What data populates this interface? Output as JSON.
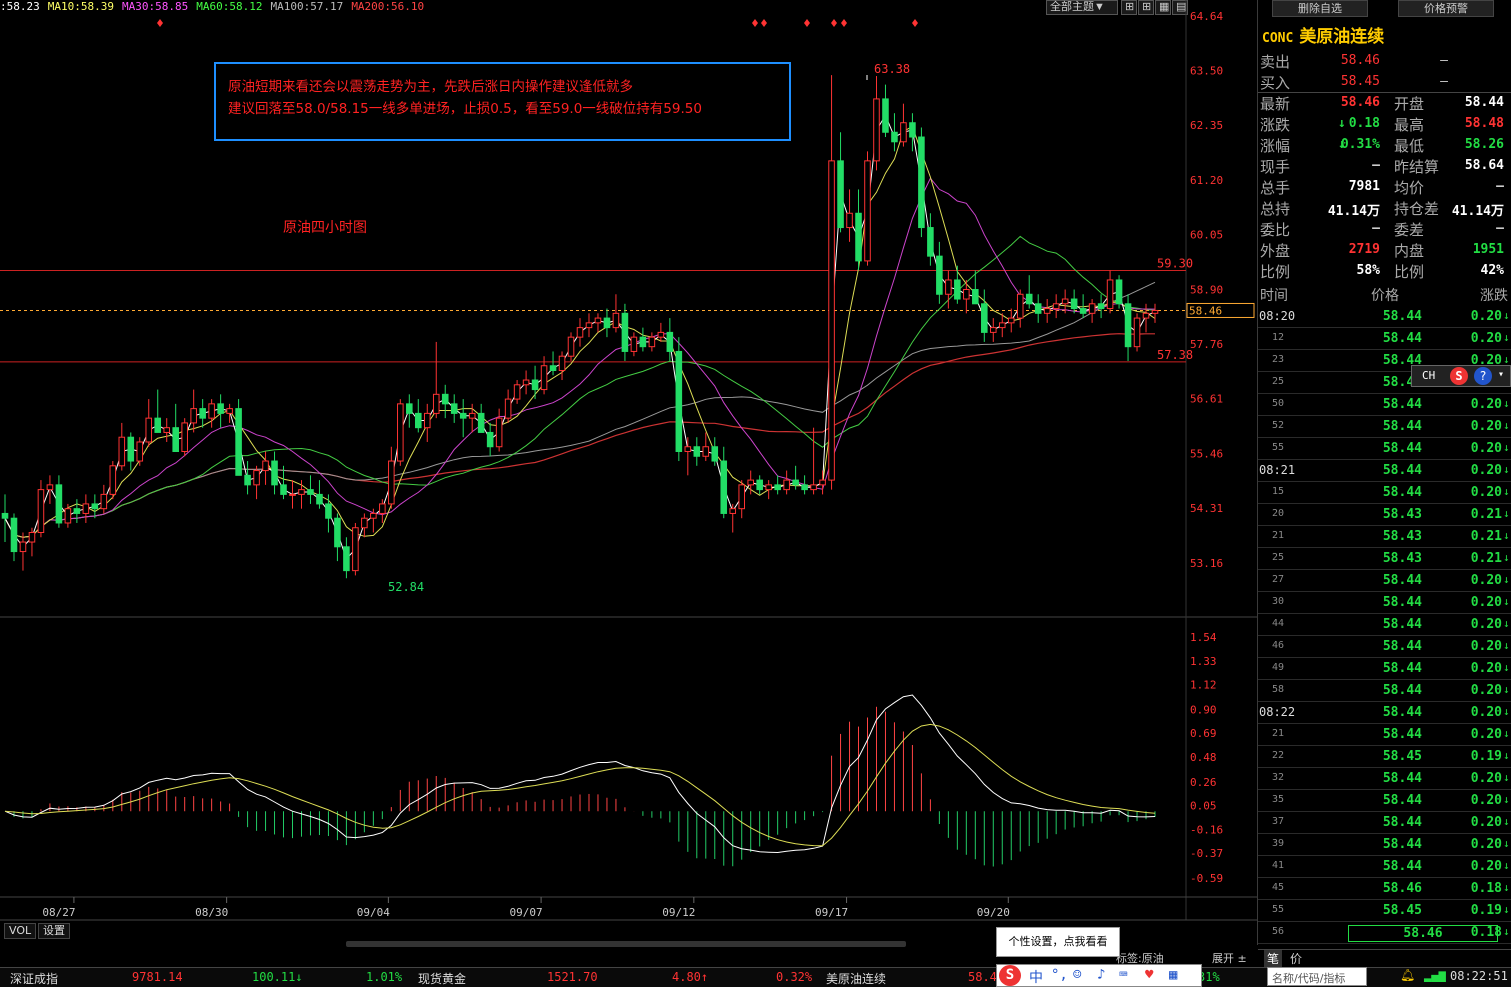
{
  "ma_legend": [
    {
      "label": ":58.23",
      "color": "#ffffff"
    },
    {
      "label": "MA10:58.39",
      "color": "#ffff66"
    },
    {
      "label": "MA30:58.85",
      "color": "#ff55ff"
    },
    {
      "label": "MA60:58.12",
      "color": "#44ff44"
    },
    {
      "label": "MA100:57.17",
      "color": "#bbbbbb"
    },
    {
      "label": "MA200:56.10",
      "color": "#ff4444"
    }
  ],
  "toolbar": {
    "theme_label": "全部主题▼",
    "icons": [
      "grid-icon",
      "grid-plus-icon",
      "grid-small-icon",
      "grid-large-icon"
    ]
  },
  "note": {
    "line1": "原油短期来看还会以震荡走势为主，先跌后涨日内操作建议逢低就多",
    "line2": "建议回落至58.0/58.15一线多单进场，止损0.5，看至59.0一线破位持有59.50"
  },
  "chart_title": "原油四小时图",
  "chart_data": [
    {
      "type": "candlestick",
      "title": "",
      "ylim": [
        52.2,
        64.9
      ],
      "y_ticks": [
        "64.64",
        "63.50",
        "62.35",
        "61.20",
        "60.05",
        "58.90",
        "57.76",
        "56.61",
        "55.46",
        "54.31",
        "53.16"
      ],
      "y_tick_values": [
        64.64,
        63.5,
        62.35,
        61.2,
        60.05,
        58.9,
        57.76,
        56.61,
        55.46,
        54.31,
        53.16
      ],
      "x_labels": [
        "08/27",
        "08/30",
        "09/04",
        "09/07",
        "09/12",
        "09/17",
        "09/20"
      ],
      "x_label_index": [
        6,
        23,
        41,
        58,
        75,
        92,
        110
      ],
      "annotations": {
        "high": "63.38",
        "low": "52.84",
        "line_upper": "59.30",
        "line_lower": "57.38",
        "current": "58.46"
      },
      "horizontal_lines": [
        59.3,
        57.38
      ],
      "current_price": 58.46,
      "candles_ohlc": [
        [
          54.2,
          54.6,
          53.6,
          54.1
        ],
        [
          54.1,
          54.2,
          53.2,
          53.4
        ],
        [
          53.4,
          53.8,
          53.0,
          53.6
        ],
        [
          53.6,
          53.9,
          53.3,
          53.8
        ],
        [
          53.8,
          54.9,
          53.7,
          54.7
        ],
        [
          54.7,
          55.0,
          54.4,
          54.8
        ],
        [
          54.8,
          55.0,
          53.9,
          54.0
        ],
        [
          54.0,
          54.4,
          53.9,
          54.3
        ],
        [
          54.3,
          54.5,
          54.0,
          54.2
        ],
        [
          54.2,
          54.6,
          54.0,
          54.4
        ],
        [
          54.4,
          54.6,
          54.1,
          54.3
        ],
        [
          54.3,
          54.8,
          54.2,
          54.6
        ],
        [
          54.6,
          55.3,
          54.5,
          55.2
        ],
        [
          55.2,
          56.1,
          55.1,
          55.8
        ],
        [
          55.8,
          55.9,
          55.1,
          55.3
        ],
        [
          55.3,
          55.8,
          55.2,
          55.7
        ],
        [
          55.7,
          56.6,
          55.6,
          56.2
        ],
        [
          56.2,
          56.8,
          56.0,
          55.9
        ],
        [
          55.9,
          56.2,
          55.7,
          56.0
        ],
        [
          56.0,
          56.5,
          55.8,
          55.5
        ],
        [
          55.5,
          56.2,
          55.4,
          56.1
        ],
        [
          56.1,
          56.8,
          55.9,
          56.4
        ],
        [
          56.4,
          56.6,
          56.0,
          56.2
        ],
        [
          56.2,
          56.6,
          56.0,
          56.5
        ],
        [
          56.5,
          56.7,
          56.0,
          56.3
        ],
        [
          56.3,
          56.5,
          56.1,
          56.4
        ],
        [
          56.4,
          56.6,
          55.3,
          55.0
        ],
        [
          55.0,
          55.3,
          54.6,
          54.8
        ],
        [
          54.8,
          55.2,
          54.5,
          55.1
        ],
        [
          55.1,
          55.5,
          54.8,
          55.3
        ],
        [
          55.3,
          55.5,
          54.6,
          54.8
        ],
        [
          54.8,
          55.2,
          54.5,
          54.6
        ],
        [
          54.6,
          54.9,
          54.3,
          54.6
        ],
        [
          54.6,
          54.9,
          54.3,
          54.7
        ],
        [
          54.7,
          55.0,
          54.4,
          54.6
        ],
        [
          54.6,
          54.9,
          54.3,
          54.4
        ],
        [
          54.4,
          54.6,
          53.8,
          54.1
        ],
        [
          54.1,
          54.2,
          53.2,
          53.5
        ],
        [
          53.5,
          53.7,
          52.84,
          53.0
        ],
        [
          53.0,
          54.0,
          52.9,
          53.9
        ],
        [
          53.9,
          54.2,
          53.7,
          54.1
        ],
        [
          54.1,
          54.3,
          53.8,
          54.2
        ],
        [
          54.2,
          54.5,
          54.0,
          54.4
        ],
        [
          54.4,
          55.6,
          54.3,
          55.3
        ],
        [
          55.3,
          56.6,
          55.2,
          56.5
        ],
        [
          56.5,
          56.7,
          56.0,
          56.3
        ],
        [
          56.3,
          56.6,
          55.9,
          56.0
        ],
        [
          56.0,
          56.5,
          55.7,
          56.3
        ],
        [
          56.3,
          57.8,
          56.2,
          56.7
        ],
        [
          56.7,
          56.9,
          56.2,
          56.5
        ],
        [
          56.5,
          56.7,
          56.1,
          56.3
        ],
        [
          56.3,
          56.6,
          55.8,
          56.2
        ],
        [
          56.2,
          56.5,
          55.9,
          56.3
        ],
        [
          56.3,
          56.5,
          56.0,
          55.9
        ],
        [
          55.9,
          56.1,
          55.4,
          55.6
        ],
        [
          55.6,
          56.4,
          55.5,
          56.2
        ],
        [
          56.2,
          56.8,
          56.1,
          56.6
        ],
        [
          56.6,
          57.0,
          56.5,
          56.9
        ],
        [
          56.9,
          57.2,
          56.7,
          57.0
        ],
        [
          57.0,
          57.3,
          56.6,
          56.8
        ],
        [
          56.8,
          57.5,
          56.7,
          57.3
        ],
        [
          57.3,
          57.6,
          57.1,
          57.2
        ],
        [
          57.2,
          57.6,
          57.0,
          57.5
        ],
        [
          57.5,
          58.0,
          57.4,
          57.9
        ],
        [
          57.9,
          58.3,
          57.7,
          58.1
        ],
        [
          58.1,
          58.4,
          57.9,
          58.2
        ],
        [
          58.2,
          58.4,
          58.0,
          58.3
        ],
        [
          58.3,
          58.5,
          57.9,
          58.1
        ],
        [
          58.1,
          58.8,
          58.0,
          58.4
        ],
        [
          58.4,
          58.6,
          57.4,
          57.6
        ],
        [
          57.6,
          58.0,
          57.5,
          57.9
        ],
        [
          57.9,
          58.1,
          57.6,
          57.7
        ],
        [
          57.7,
          58.0,
          57.6,
          57.9
        ],
        [
          57.9,
          58.2,
          57.8,
          58.0
        ],
        [
          58.0,
          58.3,
          57.4,
          57.6
        ],
        [
          57.6,
          57.9,
          55.3,
          55.5
        ],
        [
          55.5,
          55.8,
          55.0,
          55.6
        ],
        [
          55.6,
          55.8,
          55.2,
          55.4
        ],
        [
          55.4,
          55.9,
          55.3,
          55.6
        ],
        [
          55.6,
          55.8,
          55.2,
          55.3
        ],
        [
          55.3,
          55.6,
          54.1,
          54.2
        ],
        [
          54.2,
          54.4,
          53.8,
          54.3
        ],
        [
          54.3,
          54.9,
          54.1,
          54.8
        ],
        [
          54.8,
          55.1,
          54.6,
          54.9
        ],
        [
          54.9,
          55.0,
          54.6,
          54.7
        ],
        [
          54.7,
          54.9,
          54.5,
          54.8
        ],
        [
          54.8,
          55.0,
          54.6,
          54.7
        ],
        [
          54.7,
          55.1,
          54.6,
          54.9
        ],
        [
          54.9,
          55.2,
          54.7,
          54.8
        ],
        [
          54.8,
          55.0,
          54.6,
          54.7
        ],
        [
          54.7,
          56.0,
          54.6,
          54.8
        ],
        [
          54.8,
          55.1,
          54.6,
          54.9
        ],
        [
          54.9,
          63.4,
          54.7,
          61.6
        ],
        [
          61.6,
          62.2,
          60.1,
          60.2
        ],
        [
          60.2,
          61.0,
          59.9,
          60.5
        ],
        [
          60.5,
          61.0,
          59.3,
          59.5
        ],
        [
          59.5,
          61.8,
          59.4,
          61.6
        ],
        [
          61.6,
          63.38,
          61.4,
          62.9
        ],
        [
          62.9,
          63.2,
          62.1,
          62.2
        ],
        [
          62.2,
          62.6,
          61.8,
          62.0
        ],
        [
          62.0,
          62.8,
          61.9,
          62.4
        ],
        [
          62.4,
          62.6,
          61.8,
          62.1
        ],
        [
          62.1,
          62.3,
          60.0,
          60.2
        ],
        [
          60.2,
          60.5,
          59.4,
          59.6
        ],
        [
          59.6,
          59.9,
          58.6,
          58.8
        ],
        [
          58.8,
          59.3,
          58.5,
          59.1
        ],
        [
          59.1,
          59.4,
          58.6,
          58.7
        ],
        [
          58.7,
          59.1,
          58.4,
          58.9
        ],
        [
          58.9,
          59.3,
          58.7,
          58.6
        ],
        [
          58.6,
          58.9,
          57.8,
          58.0
        ],
        [
          58.0,
          58.3,
          57.8,
          58.1
        ],
        [
          58.1,
          58.4,
          57.9,
          58.2
        ],
        [
          58.2,
          58.5,
          58.0,
          58.3
        ],
        [
          58.3,
          58.9,
          58.1,
          58.8
        ],
        [
          58.8,
          59.2,
          58.5,
          58.6
        ],
        [
          58.6,
          58.8,
          58.2,
          58.4
        ],
        [
          58.4,
          58.7,
          58.2,
          58.5
        ],
        [
          58.5,
          58.8,
          58.3,
          58.6
        ],
        [
          58.6,
          58.9,
          58.4,
          58.7
        ],
        [
          58.7,
          58.9,
          58.4,
          58.5
        ],
        [
          58.5,
          58.8,
          58.3,
          58.4
        ],
        [
          58.4,
          58.7,
          58.2,
          58.6
        ],
        [
          58.6,
          58.8,
          58.3,
          58.5
        ],
        [
          58.5,
          59.3,
          58.4,
          59.1
        ],
        [
          59.1,
          59.2,
          58.5,
          58.6
        ],
        [
          58.6,
          58.8,
          57.4,
          57.7
        ],
        [
          57.7,
          58.4,
          57.6,
          58.3
        ],
        [
          58.3,
          58.6,
          58.0,
          58.4
        ],
        [
          58.4,
          58.6,
          58.2,
          58.46
        ]
      ]
    },
    {
      "type": "macd",
      "title": "",
      "ylim": [
        -0.75,
        1.65
      ],
      "y_ticks": [
        "1.54",
        "1.33",
        "1.12",
        "0.90",
        "0.69",
        "0.48",
        "0.26",
        "0.05",
        "-0.16",
        "-0.37",
        "-0.59"
      ],
      "y_tick_values": [
        1.54,
        1.33,
        1.12,
        0.9,
        0.69,
        0.48,
        0.26,
        0.05,
        -0.16,
        -0.37,
        -0.59
      ],
      "zero_line": 0
    }
  ],
  "right_panel": {
    "buttons": [
      "删除自选",
      "价格预警"
    ],
    "code": "CONC",
    "name": "美原油连续",
    "sell": {
      "label": "卖出",
      "price": "58.46",
      "vol": "—"
    },
    "buy": {
      "label": "买入",
      "price": "58.45",
      "vol": "—"
    },
    "stats": [
      {
        "l1": "最新",
        "v1": "58.46",
        "c1": "#ff3333",
        "l2": "开盘",
        "v2": "58.44",
        "c2": "#ffffff"
      },
      {
        "l1": "涨跌",
        "v1": "0.18",
        "c1": "#22dd44",
        "a1": "↓",
        "l2": "最高",
        "v2": "58.48",
        "c2": "#ff3333"
      },
      {
        "l1": "涨幅",
        "v1": "0.31%",
        "c1": "#22dd44",
        "a1": "↓",
        "l2": "最低",
        "v2": "58.26",
        "c2": "#22dd44"
      },
      {
        "l1": "现手",
        "v1": "—",
        "c1": "#cccccc",
        "l2": "昨结算",
        "v2": "58.64",
        "c2": "#ffffff"
      },
      {
        "l1": "总手",
        "v1": "7981",
        "c1": "#ffffff",
        "l2": "均价",
        "v2": "—",
        "c2": "#cccccc"
      },
      {
        "l1": "总持",
        "v1": "41.14万",
        "c1": "#ffffff",
        "l2": "持仓差",
        "v2": "41.14万",
        "c2": "#ffffff"
      },
      {
        "l1": "委比",
        "v1": "—",
        "c1": "#cccccc",
        "l2": "委差",
        "v2": "—",
        "c2": "#cccccc"
      },
      {
        "l1": "外盘",
        "v1": "2719",
        "c1": "#ff3333",
        "l2": "内盘",
        "v2": "1951",
        "c2": "#22dd44"
      },
      {
        "l1": "比例",
        "v1": "58%",
        "c1": "#ffffff",
        "l2": "比例",
        "v2": "42%",
        "c2": "#ffffff"
      }
    ],
    "tick_head": {
      "time": "时间",
      "price": "价格",
      "change": "涨跌"
    },
    "ticks": [
      {
        "t": "08:20",
        "p": "58.44",
        "c": "0.20",
        "major": true
      },
      {
        "t": "12",
        "p": "58.44",
        "c": "0.20"
      },
      {
        "t": "23",
        "p": "58.44",
        "c": "0.20"
      },
      {
        "t": "25",
        "p": "58.44",
        "c": "0.20"
      },
      {
        "t": "50",
        "p": "58.44",
        "c": "0.20"
      },
      {
        "t": "52",
        "p": "58.44",
        "c": "0.20"
      },
      {
        "t": "55",
        "p": "58.44",
        "c": "0.20"
      },
      {
        "t": "08:21",
        "p": "58.44",
        "c": "0.20",
        "major": true
      },
      {
        "t": "15",
        "p": "58.44",
        "c": "0.20"
      },
      {
        "t": "20",
        "p": "58.43",
        "c": "0.21"
      },
      {
        "t": "21",
        "p": "58.43",
        "c": "0.21"
      },
      {
        "t": "25",
        "p": "58.43",
        "c": "0.21"
      },
      {
        "t": "27",
        "p": "58.44",
        "c": "0.20"
      },
      {
        "t": "30",
        "p": "58.44",
        "c": "0.20"
      },
      {
        "t": "44",
        "p": "58.44",
        "c": "0.20"
      },
      {
        "t": "46",
        "p": "58.44",
        "c": "0.20"
      },
      {
        "t": "49",
        "p": "58.44",
        "c": "0.20"
      },
      {
        "t": "58",
        "p": "58.44",
        "c": "0.20"
      },
      {
        "t": "08:22",
        "p": "58.44",
        "c": "0.20",
        "major": true
      },
      {
        "t": "21",
        "p": "58.44",
        "c": "0.20"
      },
      {
        "t": "22",
        "p": "58.45",
        "c": "0.19"
      },
      {
        "t": "32",
        "p": "58.44",
        "c": "0.20"
      },
      {
        "t": "35",
        "p": "58.44",
        "c": "0.20"
      },
      {
        "t": "37",
        "p": "58.44",
        "c": "0.20"
      },
      {
        "t": "39",
        "p": "58.44",
        "c": "0.20"
      },
      {
        "t": "41",
        "p": "58.44",
        "c": "0.20"
      },
      {
        "t": "45",
        "p": "58.46",
        "c": "0.18"
      },
      {
        "t": "55",
        "p": "58.45",
        "c": "0.19"
      },
      {
        "t": "56",
        "p": "58.46",
        "c": "0.18"
      }
    ],
    "bottom_tabs": [
      "笔",
      "价"
    ]
  },
  "indicator_tabs": [
    "VOL",
    "设置"
  ],
  "bottom_buttons": {
    "expand": "展开 ±",
    "tag": "标签:原油"
  },
  "tooltip": "个性设置，点我看看",
  "statusbar": [
    {
      "text": "深证成指",
      "color": "#dddddd"
    },
    {
      "text": "9781.14",
      "color": "#ff3333"
    },
    {
      "text": "100.11↓",
      "color": "#22dd44"
    },
    {
      "text": "1.01%",
      "color": "#22dd44"
    },
    {
      "text": "现货黄金",
      "color": "#dddddd"
    },
    {
      "text": "1521.70",
      "color": "#ff3333"
    },
    {
      "text": "4.80↑",
      "color": "#ff3333"
    },
    {
      "text": "0.32%",
      "color": "#ff3333"
    },
    {
      "text": "美原油连续",
      "color": "#dddddd"
    },
    {
      "text": "58.4",
      "color": "#ff3333"
    },
    {
      "text": "31%",
      "color": "#22dd44"
    }
  ],
  "search_placeholder": "名称/代码/指标",
  "clock": "08:22:51",
  "ime": {
    "lang": "中"
  }
}
